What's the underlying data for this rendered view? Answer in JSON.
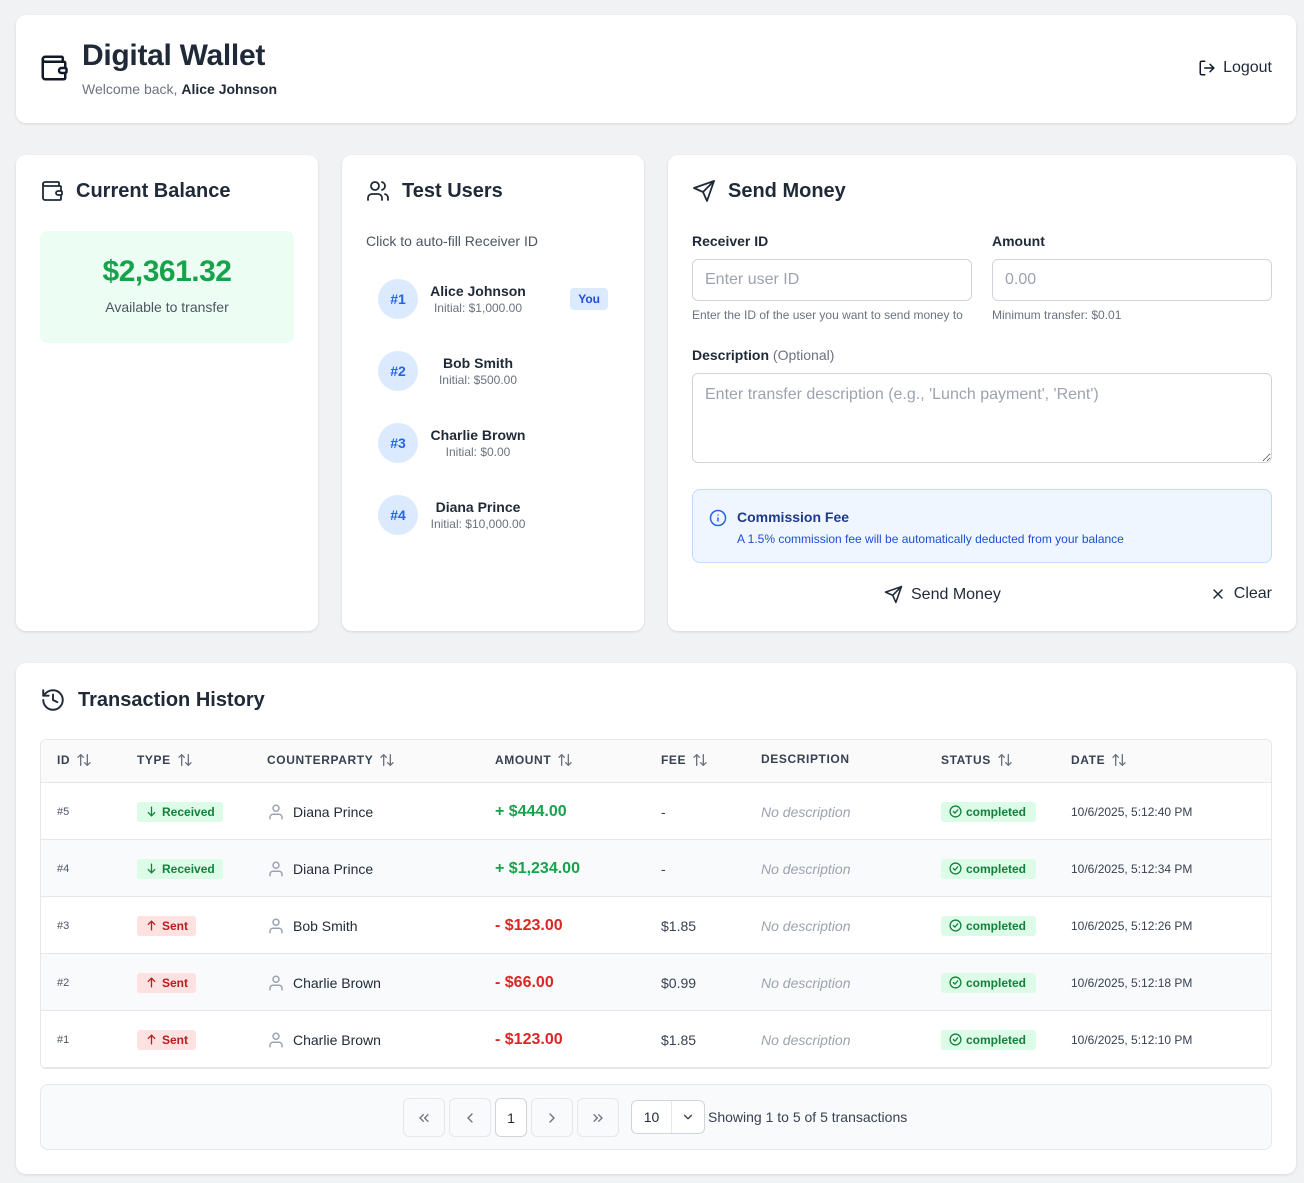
{
  "header": {
    "title": "Digital Wallet",
    "welcome_prefix": "Welcome back,",
    "user_name": "Alice Johnson",
    "logout_label": "Logout"
  },
  "balance": {
    "title": "Current Balance",
    "amount": "$2,361.32",
    "subtitle": "Available to transfer"
  },
  "test_users": {
    "title": "Test Users",
    "hint": "Click to auto-fill Receiver ID",
    "users": [
      {
        "id": "#1",
        "name": "Alice Johnson",
        "initial": "Initial: $1,000.00",
        "badge": "You"
      },
      {
        "id": "#2",
        "name": "Bob Smith",
        "initial": "Initial: $500.00"
      },
      {
        "id": "#3",
        "name": "Charlie Brown",
        "initial": "Initial: $0.00"
      },
      {
        "id": "#4",
        "name": "Diana Prince",
        "initial": "Initial: $10,000.00"
      }
    ]
  },
  "send": {
    "title": "Send Money",
    "receiver_label": "Receiver ID",
    "receiver_placeholder": "Enter user ID",
    "receiver_help": "Enter the ID of the user you want to send money to",
    "amount_label": "Amount",
    "amount_placeholder": "0.00",
    "amount_help": "Minimum transfer: $0.01",
    "description_label": "Description",
    "description_optional": "(Optional)",
    "description_placeholder": "Enter transfer description (e.g., 'Lunch payment', 'Rent')",
    "fee_title": "Commission Fee",
    "fee_text": "A 1.5% commission fee will be automatically deducted from your balance",
    "send_label": "Send Money",
    "clear_label": "Clear"
  },
  "history": {
    "title": "Transaction History",
    "columns": {
      "id": "ID",
      "type": "TYPE",
      "counterparty": "COUNTERPARTY",
      "amount": "AMOUNT",
      "fee": "FEE",
      "description": "DESCRIPTION",
      "status": "STATUS",
      "date": "DATE"
    },
    "rows": [
      {
        "id": "#5",
        "type": "Received",
        "direction": "in",
        "counterparty": "Diana Prince",
        "amount": "+ $444.00",
        "fee": "-",
        "description": "No description",
        "status": "completed",
        "date": "10/6/2025, 5:12:40 PM"
      },
      {
        "id": "#4",
        "type": "Received",
        "direction": "in",
        "counterparty": "Diana Prince",
        "amount": "+ $1,234.00",
        "fee": "-",
        "description": "No description",
        "status": "completed",
        "date": "10/6/2025, 5:12:34 PM"
      },
      {
        "id": "#3",
        "type": "Sent",
        "direction": "out",
        "counterparty": "Bob Smith",
        "amount": "- $123.00",
        "fee": "$1.85",
        "description": "No description",
        "status": "completed",
        "date": "10/6/2025, 5:12:26 PM"
      },
      {
        "id": "#2",
        "type": "Sent",
        "direction": "out",
        "counterparty": "Charlie Brown",
        "amount": "- $66.00",
        "fee": "$0.99",
        "description": "No description",
        "status": "completed",
        "date": "10/6/2025, 5:12:18 PM"
      },
      {
        "id": "#1",
        "type": "Sent",
        "direction": "out",
        "counterparty": "Charlie Brown",
        "amount": "- $123.00",
        "fee": "$1.85",
        "description": "No description",
        "status": "completed",
        "date": "10/6/2025, 5:12:10 PM"
      }
    ],
    "pagination": {
      "current_page": "1",
      "page_size": "10",
      "summary": "Showing 1 to 5 of 5 transactions"
    }
  },
  "colors": {
    "positive": "#16a34a",
    "negative": "#dc2626",
    "accent": "#2563eb",
    "background": "#f1f2f4"
  },
  "icons": {
    "logo": "wallet-icon",
    "logout": "logout-icon",
    "users": "users-icon",
    "send": "paper-plane-icon",
    "info": "info-icon",
    "history": "history-icon",
    "sort": "sort-arrows-icon",
    "received": "arrow-down-icon",
    "sent": "arrow-up-icon",
    "person": "user-icon",
    "status": "check-circle-icon"
  }
}
